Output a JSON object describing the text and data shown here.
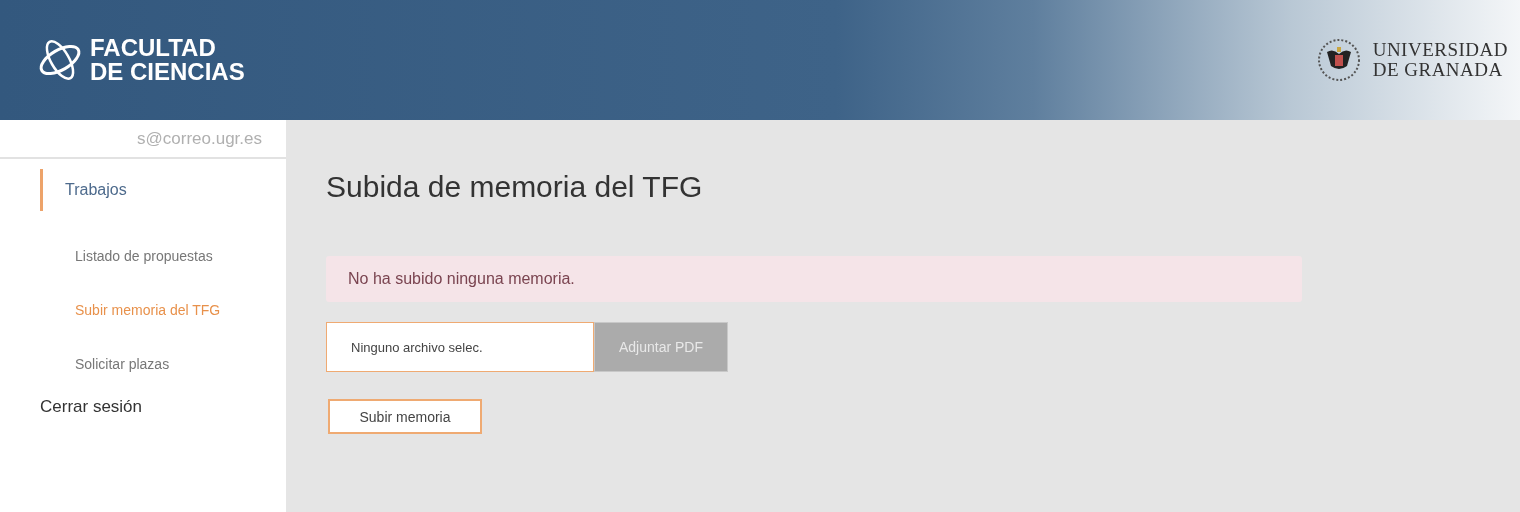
{
  "header": {
    "faculty_name": [
      "FACULTAD",
      "DE CIENCIAS"
    ],
    "university_name": [
      "UNIVERSIDAD",
      "DE GRANADA"
    ]
  },
  "sidebar": {
    "user_email": "s@correo.ugr.es",
    "items": [
      {
        "label": "Trabajos",
        "selected": true,
        "children": [
          {
            "label": "Listado de propuestas",
            "selected": false
          },
          {
            "label": "Subir memoria del TFG",
            "selected": true
          },
          {
            "label": "Solicitar plazas",
            "selected": false
          }
        ]
      },
      {
        "label": "Cerrar sesión",
        "selected": false
      }
    ]
  },
  "main": {
    "title": "Subida de memoria del TFG",
    "alert": "No ha subido ninguna memoria.",
    "file_input": {
      "value": "Ninguno archivo selec.",
      "button": "Adjuntar PDF"
    },
    "submit_button": "Subir memoria"
  }
}
